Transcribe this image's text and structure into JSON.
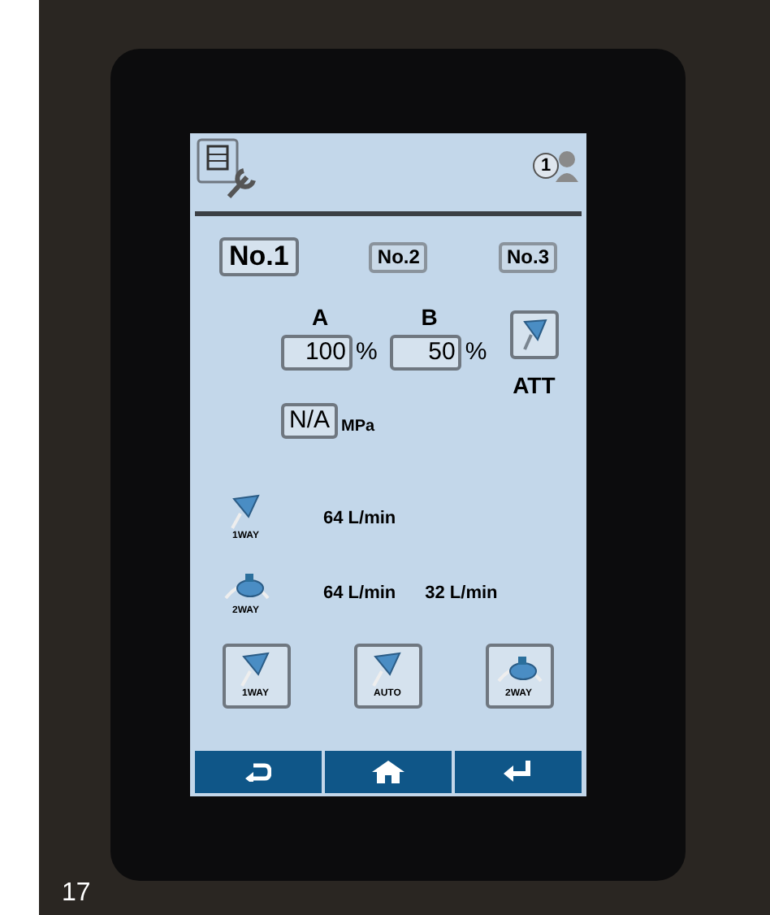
{
  "operator_number": "1",
  "tabs": [
    {
      "label": "No.1",
      "selected": true
    },
    {
      "label": "No.2",
      "selected": false
    },
    {
      "label": "No.3",
      "selected": false
    }
  ],
  "ratios": [
    {
      "heading": "A",
      "value": "100",
      "unit": "%"
    },
    {
      "heading": "B",
      "value": "50",
      "unit": "%"
    }
  ],
  "att_label": "ATT",
  "pressure": {
    "value": "N/A",
    "unit": "MPa"
  },
  "flows": [
    {
      "kind": "one_way",
      "icon_label": "1WAY",
      "values": [
        "64 L/min"
      ]
    },
    {
      "kind": "two_way",
      "icon_label": "2WAY",
      "values": [
        "64 L/min",
        "32 L/min"
      ]
    }
  ],
  "mode_buttons": [
    {
      "kind": "one_way",
      "label": "1WAY"
    },
    {
      "kind": "auto",
      "label": "AUTO"
    },
    {
      "kind": "two_way",
      "label": "2WAY"
    }
  ],
  "nav_buttons": [
    {
      "kind": "back"
    },
    {
      "kind": "home"
    },
    {
      "kind": "enter"
    }
  ],
  "page_number": "17"
}
